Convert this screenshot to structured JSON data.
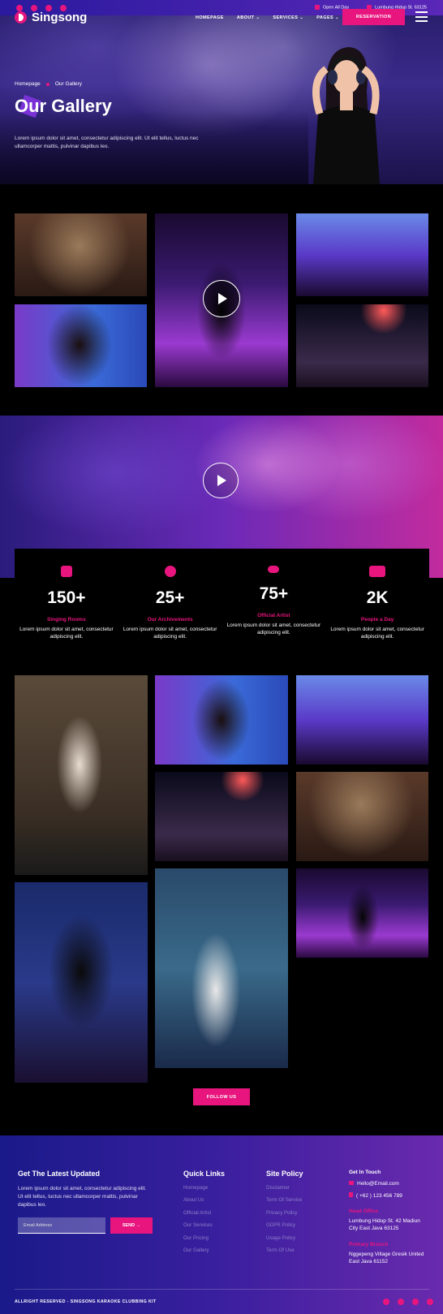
{
  "topbar": {
    "hours": "Open All Day",
    "address": "Lumbung Hidup St. 63125",
    "social_icons": [
      "facebook-icon",
      "twitter-icon",
      "youtube-icon",
      "instagram-icon"
    ]
  },
  "brand": {
    "name": "Singsong",
    "accent": "#e8157e"
  },
  "nav": {
    "items": [
      "HOMEPAGE",
      "ABOUT ⌄",
      "SERVICES ⌄",
      "PAGES ⌄"
    ],
    "reservation": "RESERVATION"
  },
  "hero": {
    "breadcrumb": [
      "Homepage",
      "Our Gallery"
    ],
    "title": "Our Gallery",
    "desc": "Lorem ipsum dolor sit amet, consectetur adipiscing elit. Ut elit tellus, luctus nec ullamcorper mattis, pulvinar dapibus leo."
  },
  "stats": [
    {
      "icon": "microphone-icon",
      "num": "150+",
      "label": "Singing Rooms",
      "desc": "Lorem ipsum dolor sit amet, consectetur adipiscing elit."
    },
    {
      "icon": "medal-icon",
      "num": "25+",
      "label": "Our Archivements",
      "desc": "Lorem ipsum dolor sit amet, consectetur adipiscing elit."
    },
    {
      "icon": "mask-icon",
      "num": "75+",
      "label": "Official Artist",
      "desc": "Lorem ipsum dolor sit amet, consectetur adipiscing elit."
    },
    {
      "icon": "users-icon",
      "num": "2K",
      "label": "People a Day",
      "desc": "Lorem ipsum dolor sit amet, consectetur adipiscing elit."
    }
  ],
  "follow": "FOLLOW US",
  "footer": {
    "newsletter": {
      "title": "Get The Latest Updated",
      "desc": "Lorem ipsum dolor sit amet, consectetur adipiscing elit. Ut elit tellus, luctus nec ullamcorper mattis, pulvinar dapibus leo.",
      "placeholder": "Email Address",
      "send": "SEND →"
    },
    "quick": {
      "title": "Quick Links",
      "items": [
        "Homepage",
        "About Us",
        "Official Artist",
        "Our Services",
        "Our Pricing",
        "Our Gallery"
      ]
    },
    "policy": {
      "title": "Site Policy",
      "items": [
        "Disclaimer",
        "Term Of Service",
        "Privacy Policy",
        "GDPR Policy",
        "Usage Policy",
        "Term Of Use"
      ]
    },
    "touch": {
      "title": "Get In Touch",
      "email": "Hello@Email.com",
      "phone": "( +62 ) 123 456 789",
      "head_label": "Head Office",
      "head_addr": "Lumbung Hidup St. 42 Madiun City East Java 63125",
      "branch_label": "Primary Branch",
      "branch_addr": "Nggepeng Village Gresik United East Java 61152"
    },
    "copyright": "ALLRIGHT RESERVED - SINGSONG KARAOKE CLUBBING KIT"
  }
}
